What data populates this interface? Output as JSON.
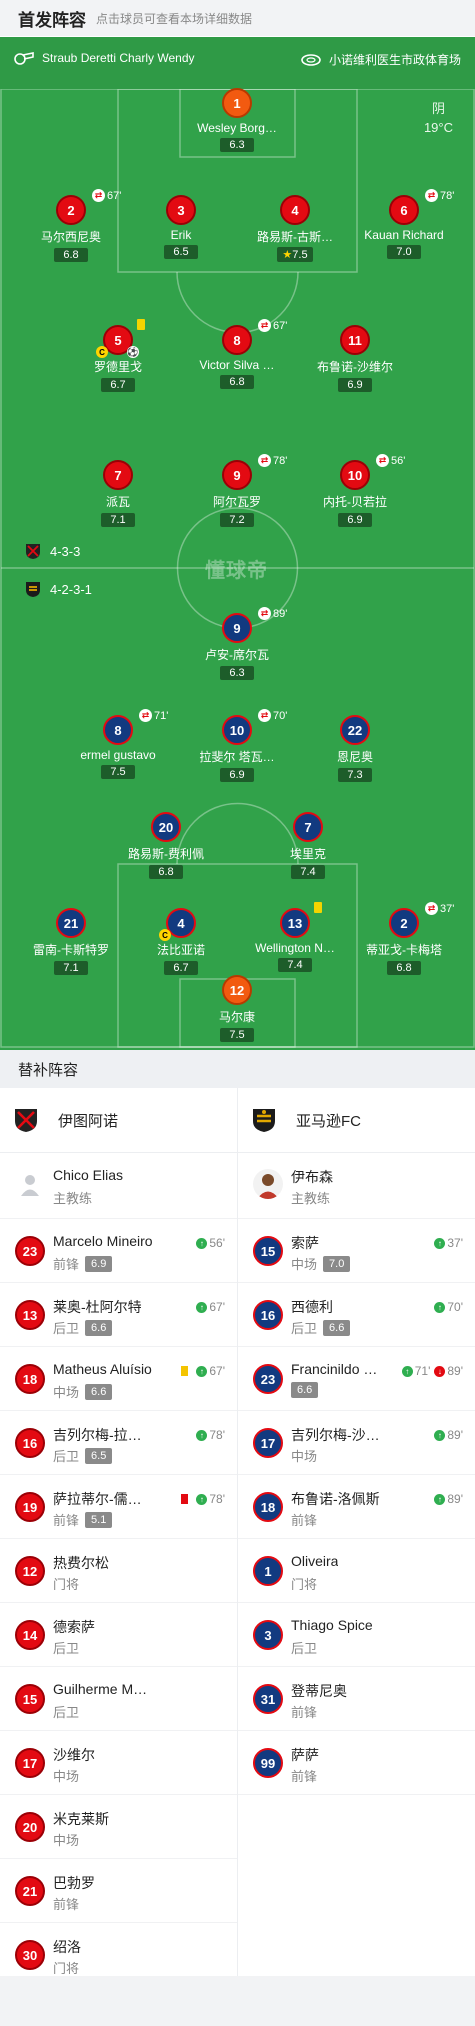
{
  "header": {
    "title": "首发阵容",
    "subtitle": "点击球员可查看本场详细数据"
  },
  "venue": {
    "referee": "Straub Deretti Charly Wendy",
    "stadium": "小诺维利医生市政体育场"
  },
  "weather": {
    "condition": "阴",
    "temp": "19°C"
  },
  "watermark": "懂球帝",
  "formations": {
    "home": "4-3-3",
    "away": "4-2-3-1"
  },
  "home_lineup": [
    {
      "num": "1",
      "name": "Wesley Borg…",
      "rating": "6.3",
      "kit": "gk"
    },
    {
      "num": "2",
      "name": "马尔西尼奥",
      "rating": "6.8",
      "kit": "red",
      "sub": "67'"
    },
    {
      "num": "3",
      "name": "Erik",
      "rating": "6.5",
      "kit": "red"
    },
    {
      "num": "4",
      "name": "路易斯-古斯…",
      "rating": "7.5",
      "kit": "red",
      "star": true
    },
    {
      "num": "6",
      "name": "Kauan Richard",
      "rating": "7.0",
      "kit": "red",
      "sub": "78'"
    },
    {
      "num": "5",
      "name": "罗德里戈",
      "rating": "6.7",
      "kit": "red",
      "yellow": true,
      "captain": true,
      "goal": true
    },
    {
      "num": "8",
      "name": "Victor Silva …",
      "rating": "6.8",
      "kit": "red",
      "sub": "67'"
    },
    {
      "num": "11",
      "name": "布鲁诺-沙维尔",
      "rating": "6.9",
      "kit": "red"
    },
    {
      "num": "7",
      "name": "派瓦",
      "rating": "7.1",
      "kit": "red"
    },
    {
      "num": "9",
      "name": "阿尔瓦罗",
      "rating": "7.2",
      "kit": "red",
      "sub": "78'"
    },
    {
      "num": "10",
      "name": "内托-贝若拉",
      "rating": "6.9",
      "kit": "red",
      "sub": "56'"
    }
  ],
  "away_lineup": [
    {
      "num": "9",
      "name": "卢安-席尔瓦",
      "rating": "6.3",
      "kit": "blue",
      "sub": "89'"
    },
    {
      "num": "8",
      "name": "ermel gustavo",
      "rating": "7.5",
      "kit": "blue",
      "sub": "71'"
    },
    {
      "num": "10",
      "name": "拉斐尔 塔瓦…",
      "rating": "6.9",
      "kit": "blue",
      "sub": "70'"
    },
    {
      "num": "22",
      "name": "恩尼奥",
      "rating": "7.3",
      "kit": "blue"
    },
    {
      "num": "20",
      "name": "路易斯-费利佩",
      "rating": "6.8",
      "kit": "blue"
    },
    {
      "num": "7",
      "name": "埃里克",
      "rating": "7.4",
      "kit": "blue"
    },
    {
      "num": "21",
      "name": "雷南-卡斯特罗",
      "rating": "7.1",
      "kit": "blue"
    },
    {
      "num": "4",
      "name": "法比亚诺",
      "rating": "6.7",
      "kit": "blue",
      "captain": true
    },
    {
      "num": "13",
      "name": "Wellington N…",
      "rating": "7.4",
      "kit": "blue",
      "yellow": true
    },
    {
      "num": "2",
      "name": "蒂亚戈-卡梅塔",
      "rating": "6.8",
      "kit": "blue",
      "sub": "37'"
    },
    {
      "num": "12",
      "name": "马尔康",
      "rating": "7.5",
      "kit": "gk"
    }
  ],
  "subs": {
    "title": "替补阵容",
    "home_team": "伊图阿诺",
    "away_team": "亚马逊FC",
    "home_coach": {
      "name": "Chico Elias",
      "role": "主教练"
    },
    "away_coach": {
      "name": "伊布森",
      "role": "主教练"
    },
    "home": [
      {
        "num": "23",
        "name": "Marcelo Mineiro",
        "pos": "前锋",
        "rating": "6.9",
        "in": "56'"
      },
      {
        "num": "13",
        "name": "莱奥-杜阿尔特",
        "pos": "后卫",
        "rating": "6.6",
        "in": "67'"
      },
      {
        "num": "18",
        "name": "Matheus Aluísio",
        "pos": "中场",
        "rating": "6.6",
        "in": "67'",
        "yellow": true
      },
      {
        "num": "16",
        "name": "吉列尔梅-拉…",
        "pos": "后卫",
        "rating": "6.5",
        "in": "78'"
      },
      {
        "num": "19",
        "name": "萨拉蒂尔-儒…",
        "pos": "前锋",
        "rating": "5.1",
        "in": "78'",
        "red": true
      },
      {
        "num": "12",
        "name": "热费尔松",
        "pos": "门将"
      },
      {
        "num": "14",
        "name": "德索萨",
        "pos": "后卫"
      },
      {
        "num": "15",
        "name": "Guilherme M…",
        "pos": "后卫"
      },
      {
        "num": "17",
        "name": "沙维尔",
        "pos": "中场"
      },
      {
        "num": "20",
        "name": "米克莱斯",
        "pos": "中场"
      },
      {
        "num": "21",
        "name": "巴勃罗",
        "pos": "前锋"
      },
      {
        "num": "30",
        "name": "绍洛",
        "pos": "门将"
      }
    ],
    "away": [
      {
        "num": "15",
        "name": "索萨",
        "pos": "中场",
        "rating": "7.0",
        "in": "37'"
      },
      {
        "num": "16",
        "name": "西德利",
        "pos": "后卫",
        "rating": "6.6",
        "in": "70'"
      },
      {
        "num": "23",
        "name": "Francinildo Pi…",
        "pos": "",
        "rating": "6.6",
        "in": "71'",
        "out": "89'"
      },
      {
        "num": "17",
        "name": "吉列尔梅-沙…",
        "pos": "中场",
        "in": "89'"
      },
      {
        "num": "18",
        "name": "布鲁诺-洛佩斯",
        "pos": "前锋",
        "in": "89'"
      },
      {
        "num": "1",
        "name": "Oliveira",
        "pos": "门将"
      },
      {
        "num": "3",
        "name": "Thiago Spice",
        "pos": "后卫"
      },
      {
        "num": "31",
        "name": "登蒂尼奥",
        "pos": "前锋"
      },
      {
        "num": "99",
        "name": "萨萨",
        "pos": "前锋"
      }
    ]
  }
}
